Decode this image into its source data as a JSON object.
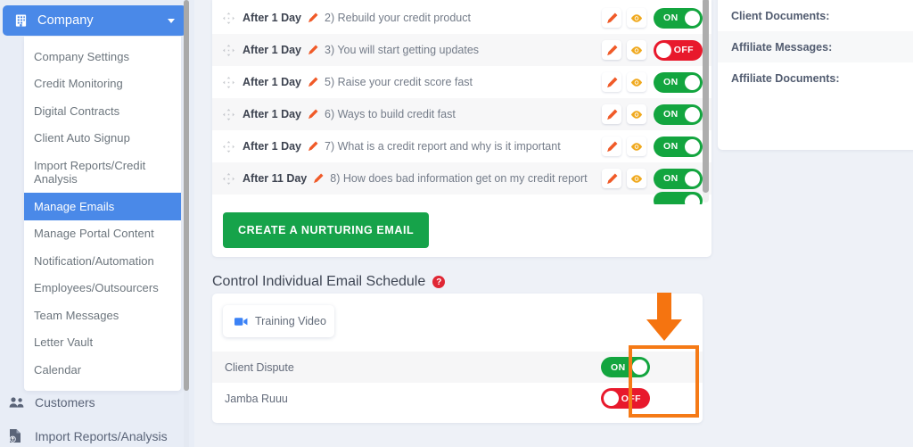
{
  "sidebar": {
    "company_button": {
      "label": "Company",
      "icon": "building-icon",
      "caret": "chevron-down-icon"
    },
    "submenu": [
      {
        "label": "Company Settings",
        "active": false
      },
      {
        "label": "Credit Monitoring",
        "active": false
      },
      {
        "label": "Digital Contracts",
        "active": false
      },
      {
        "label": "Client Auto Signup",
        "active": false
      },
      {
        "label": "Import Reports/Credit Analysis",
        "active": false
      },
      {
        "label": "Manage Emails",
        "active": true
      },
      {
        "label": "Manage Portal Content",
        "active": false
      },
      {
        "label": "Notification/Automation",
        "active": false
      },
      {
        "label": "Employees/Outsourcers",
        "active": false
      },
      {
        "label": "Team Messages",
        "active": false
      },
      {
        "label": "Letter Vault",
        "active": false
      },
      {
        "label": "Calendar",
        "active": false
      }
    ],
    "root_items": [
      {
        "label": "Customers",
        "icon": "people-icon"
      },
      {
        "label": "Import Reports/Analysis",
        "icon": "file-upload-icon"
      }
    ]
  },
  "emails": {
    "rows": [
      {
        "delay": "After 1 Day",
        "subject": "2) Rebuild your credit product",
        "toggle": "ON"
      },
      {
        "delay": "After 1 Day",
        "subject": "3) You will start getting updates",
        "toggle": "OFF"
      },
      {
        "delay": "After 1 Day",
        "subject": "5) Raise your credit score fast",
        "toggle": "ON"
      },
      {
        "delay": "After 1 Day",
        "subject": "6) Ways to build credit fast",
        "toggle": "ON"
      },
      {
        "delay": "After 1 Day",
        "subject": "7) What is a credit report and why is it important",
        "toggle": "ON"
      },
      {
        "delay": "After 11 Day",
        "subject": "8) How does bad information get on my credit report",
        "toggle": "ON"
      }
    ],
    "row_icons": {
      "drag": "drag-move-icon",
      "edit_delay": "pencil-icon",
      "edit": "pencil-icon",
      "preview": "eye-icon"
    },
    "create_button": "CREATE A NURTURING EMAIL"
  },
  "schedule": {
    "title": "Control Individual Email Schedule",
    "help_icon": "question-mark-icon",
    "help_glyph": "?",
    "training_button": {
      "label": "Training Video",
      "icon": "video-camera-icon"
    },
    "rows": [
      {
        "name": "Client Dispute",
        "toggle": "ON"
      },
      {
        "name": "Jamba Ruuu",
        "toggle": "OFF"
      }
    ],
    "highlight": {
      "box_color": "#f57a16",
      "arrow": "arrow-down-icon"
    }
  },
  "right_panel": {
    "rows": [
      {
        "label": "Client Documents:"
      },
      {
        "label": "Affiliate Messages:"
      },
      {
        "label": "Affiliate Documents:"
      }
    ]
  },
  "colors": {
    "toggle_on": "#13a53f",
    "toggle_off": "#e8192c",
    "accent_blue": "#4a89e8",
    "green_button": "#16a34a",
    "highlight_orange": "#f57a16",
    "help_red": "#e02735"
  }
}
